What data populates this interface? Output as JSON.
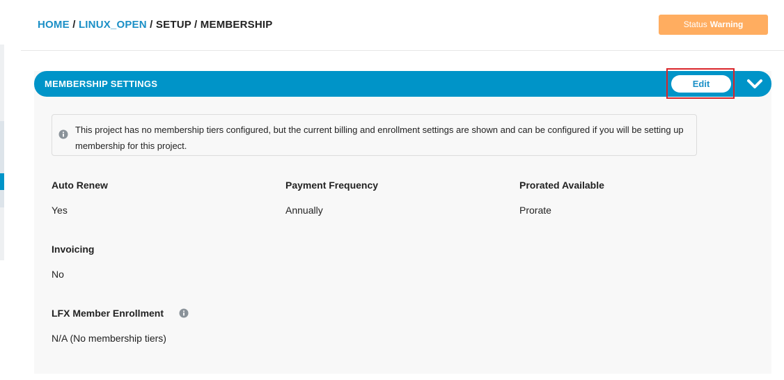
{
  "breadcrumb": {
    "home": "HOME",
    "sep1": "/",
    "project": "LINUX_OPEN",
    "sep2": "/",
    "setup": "SETUP",
    "sep3": "/",
    "current": "MEMBERSHIP"
  },
  "status": {
    "label": "Status",
    "value": "Warning",
    "color": "#ffad60"
  },
  "panel": {
    "title": "MEMBERSHIP SETTINGS",
    "edit_label": "Edit",
    "accent_color": "#0094c8",
    "notice": "This project has no membership tiers configured, but the current billing and enrollment settings are shown and can be configured if you will be setting up membership for this project."
  },
  "fields": {
    "auto_renew": {
      "label": "Auto Renew",
      "value": "Yes"
    },
    "payment_frequency": {
      "label": "Payment Frequency",
      "value": "Annually"
    },
    "prorated_available": {
      "label": "Prorated Available",
      "value": "Prorate"
    },
    "invoicing": {
      "label": "Invoicing",
      "value": "No"
    },
    "lfx_member_enrollment": {
      "label": "LFX Member Enrollment",
      "value": "N/A (No membership tiers)"
    }
  },
  "icons": {
    "notice": "info-icon",
    "enrollment_info": "info-icon",
    "collapse": "chevron-down-icon"
  }
}
